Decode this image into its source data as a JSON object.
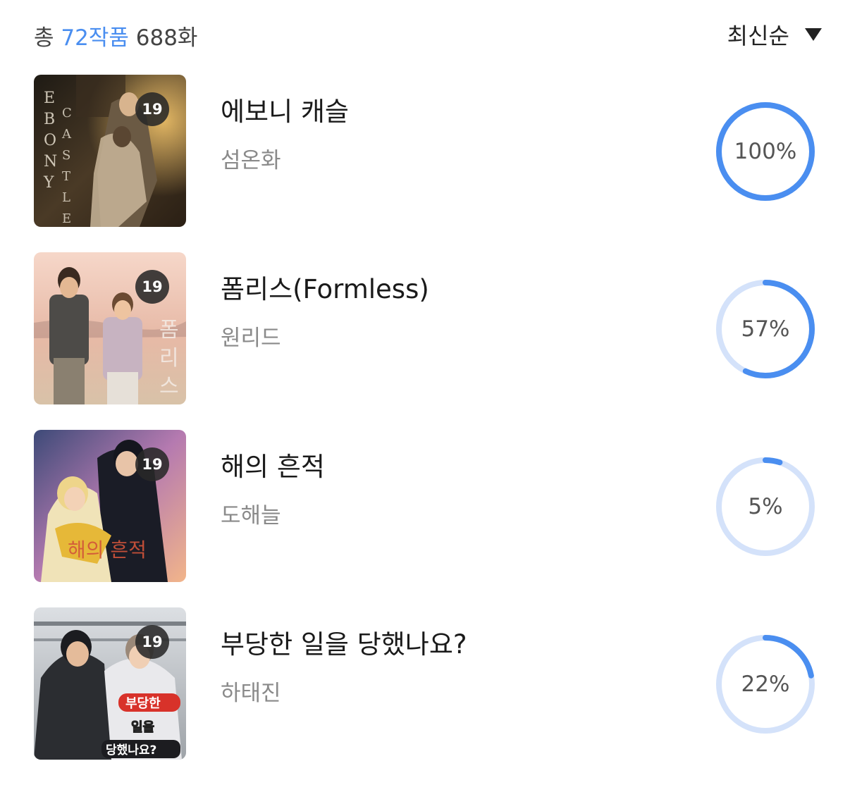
{
  "header": {
    "summary_prefix": "총",
    "works_count": "72작품",
    "episodes_count": "688화",
    "sort_label": "최신순"
  },
  "colors": {
    "accent": "#4a8ef0",
    "track": "#d4e2fa"
  },
  "items": [
    {
      "title": "에보니 캐슬",
      "author": "섬온화",
      "badge": "19",
      "progress": 100,
      "progress_label": "100%",
      "cover_text": "EBONY CASTLE"
    },
    {
      "title": "폼리스(Formless)",
      "author": "원리드",
      "badge": "19",
      "progress": 57,
      "progress_label": "57%",
      "cover_text": "폼리스"
    },
    {
      "title": "해의 흔적",
      "author": "도해늘",
      "badge": "19",
      "progress": 5,
      "progress_label": "5%",
      "cover_text": "해의 흔적"
    },
    {
      "title": "부당한 일을 당했나요?",
      "author": "하태진",
      "badge": "19",
      "progress": 22,
      "progress_label": "22%",
      "cover_text": "부당한 일을 당했나요?"
    }
  ]
}
